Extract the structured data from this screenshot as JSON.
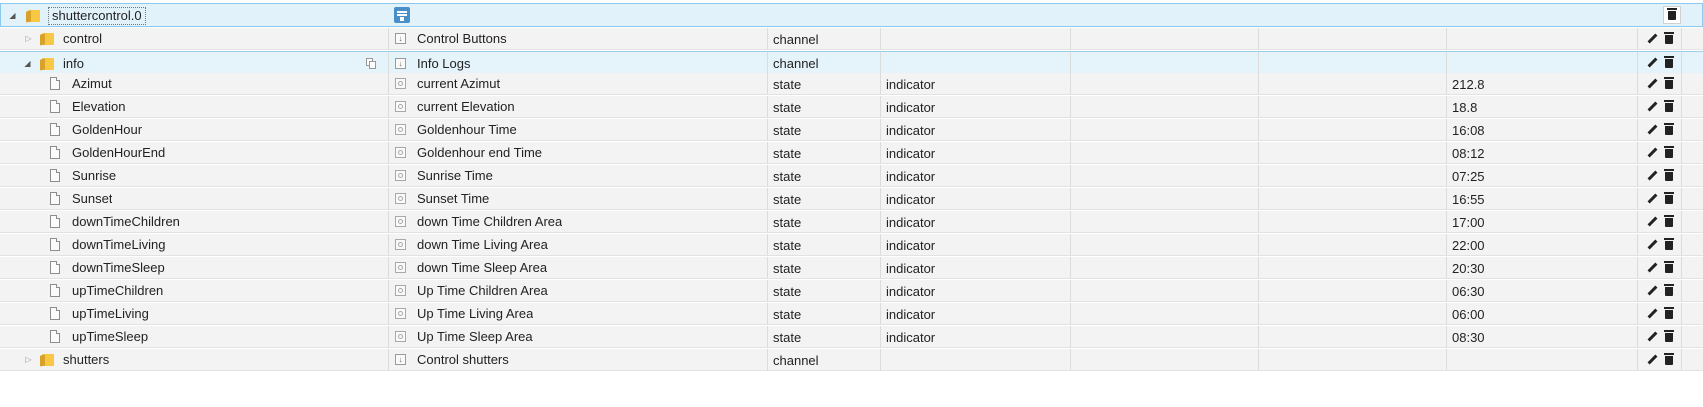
{
  "root": {
    "id": "shuttercontrol.0"
  },
  "rows": [
    {
      "id": "control",
      "name": "Control Buttons",
      "type": "channel",
      "role": "",
      "value": ""
    },
    {
      "id": "info",
      "name": "Info Logs",
      "type": "channel",
      "role": "",
      "value": ""
    },
    {
      "id": "Azimut",
      "name": "current Azimut",
      "type": "state",
      "role": "indicator",
      "value": "212.8"
    },
    {
      "id": "Elevation",
      "name": "current Elevation",
      "type": "state",
      "role": "indicator",
      "value": "18.8"
    },
    {
      "id": "GoldenHour",
      "name": "Goldenhour Time",
      "type": "state",
      "role": "indicator",
      "value": "16:08"
    },
    {
      "id": "GoldenHourEnd",
      "name": "Goldenhour end Time",
      "type": "state",
      "role": "indicator",
      "value": "08:12"
    },
    {
      "id": "Sunrise",
      "name": "Sunrise Time",
      "type": "state",
      "role": "indicator",
      "value": "07:25"
    },
    {
      "id": "Sunset",
      "name": "Sunset Time",
      "type": "state",
      "role": "indicator",
      "value": "16:55"
    },
    {
      "id": "downTimeChildren",
      "name": "down Time Children Area",
      "type": "state",
      "role": "indicator",
      "value": "17:00"
    },
    {
      "id": "downTimeLiving",
      "name": "down Time Living Area",
      "type": "state",
      "role": "indicator",
      "value": "22:00"
    },
    {
      "id": "downTimeSleep",
      "name": "down Time Sleep Area",
      "type": "state",
      "role": "indicator",
      "value": "20:30"
    },
    {
      "id": "upTimeChildren",
      "name": "Up Time Children Area",
      "type": "state",
      "role": "indicator",
      "value": "06:30"
    },
    {
      "id": "upTimeLiving",
      "name": "Up Time Living Area",
      "type": "state",
      "role": "indicator",
      "value": "06:00"
    },
    {
      "id": "upTimeSleep",
      "name": "Up Time Sleep Area",
      "type": "state",
      "role": "indicator",
      "value": "08:30"
    },
    {
      "id": "shutters",
      "name": "Control shutters",
      "type": "channel",
      "role": "",
      "value": ""
    }
  ],
  "icons": {
    "expanded": "triangle-down-icon",
    "collapsed": "triangle-right-icon",
    "folder": "folder-icon",
    "state": "file-icon",
    "edit": "pencil-icon",
    "delete": "trash-icon",
    "copy": "copy-icon",
    "adapter": "adapter-icon"
  },
  "colors": {
    "root_bg": "#e2f2fb",
    "selected_bg": "#e5f3fb",
    "row_bg": "#f3f3f3",
    "folder": "#f7c843"
  }
}
